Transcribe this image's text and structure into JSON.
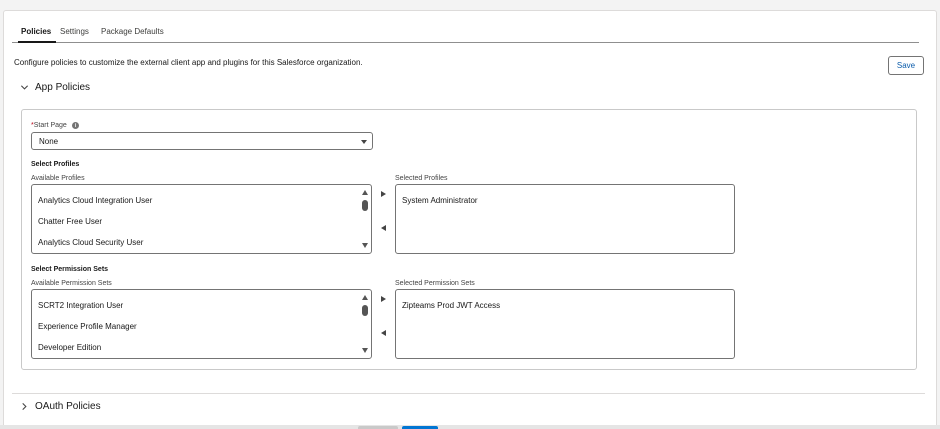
{
  "tabs": [
    {
      "label": "Policies",
      "active": true
    },
    {
      "label": "Settings",
      "active": false
    },
    {
      "label": "Package Defaults",
      "active": false
    }
  ],
  "description": "Configure policies to customize the external client app and plugins for this Salesforce organization.",
  "save_label": "Save",
  "app_policies": {
    "title": "App Policies",
    "start_page": {
      "required_mark": "*",
      "label": "Start Page",
      "info_glyph": "i",
      "value": "None"
    },
    "profiles": {
      "heading": "Select Profiles",
      "available_label": "Available Profiles",
      "selected_label": "Selected Profiles",
      "available": [
        "Analytics Cloud Integration User",
        "Chatter Free User",
        "Analytics Cloud Security User"
      ],
      "selected": [
        "System Administrator"
      ]
    },
    "permission_sets": {
      "heading": "Select Permission Sets",
      "available_label": "Available Permission Sets",
      "selected_label": "Selected Permission Sets",
      "available": [
        "SCRT2 Integration User",
        "Experience Profile Manager",
        "Developer Edition"
      ],
      "selected": [
        "Zipteams Prod JWT Access"
      ]
    }
  },
  "oauth_policies": {
    "title": "OAuth Policies"
  },
  "colors": {
    "accent": "#0176d3",
    "link": "#0b5cab",
    "border": "#747474"
  },
  "icons": [
    "chevron-down-icon",
    "chevron-right-icon",
    "info-icon",
    "select-caret-icon",
    "move-right-icon",
    "move-left-icon"
  ]
}
